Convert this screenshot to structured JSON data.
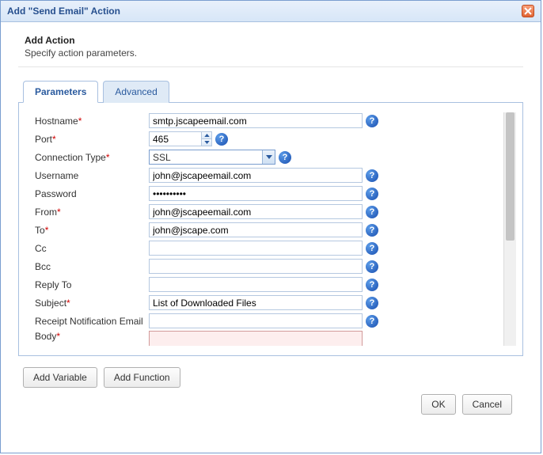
{
  "window": {
    "title": "Add \"Send Email\" Action"
  },
  "header": {
    "title": "Add Action",
    "subtitle": "Specify action parameters."
  },
  "tabs": {
    "parameters": "Parameters",
    "advanced": "Advanced"
  },
  "labels": {
    "hostname": "Hostname",
    "port": "Port",
    "connection_type": "Connection Type",
    "username": "Username",
    "password": "Password",
    "from": "From",
    "to": "To",
    "cc": "Cc",
    "bcc": "Bcc",
    "reply_to": "Reply To",
    "subject": "Subject",
    "receipt": "Receipt Notification Email",
    "body": "Body",
    "req_marker": "*"
  },
  "values": {
    "hostname": "smtp.jscapeemail.com",
    "port": "465",
    "connection_type": "SSL",
    "username": "john@jscapeemail.com",
    "password": "••••••••••",
    "from": "john@jscapeemail.com",
    "to": "john@jscape.com",
    "cc": "",
    "bcc": "",
    "reply_to": "",
    "subject": "List of Downloaded Files",
    "receipt": "",
    "body": ""
  },
  "buttons": {
    "add_variable": "Add Variable",
    "add_function": "Add Function",
    "ok": "OK",
    "cancel": "Cancel"
  },
  "help_glyph": "?"
}
